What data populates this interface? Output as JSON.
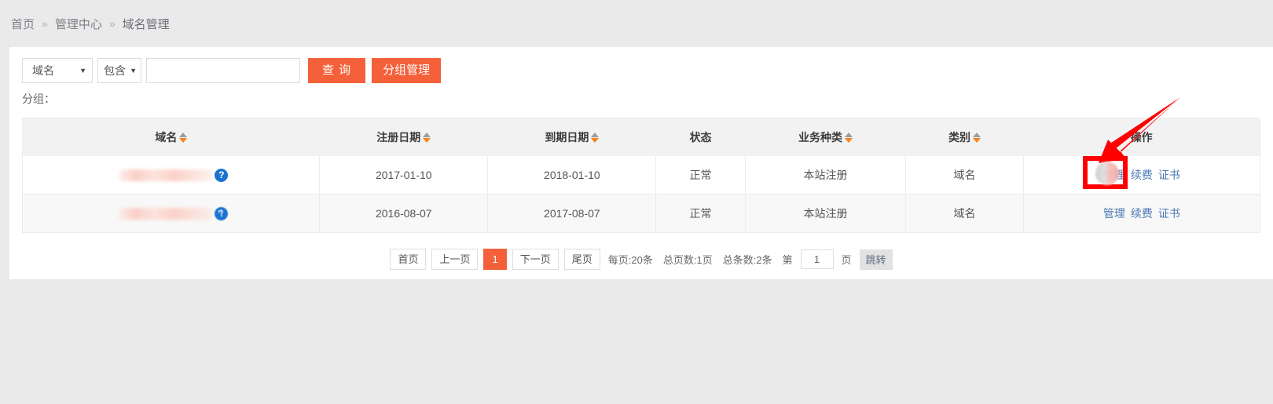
{
  "breadcrumb": {
    "separator": "»",
    "items": [
      {
        "label": "首页"
      },
      {
        "label": "管理中心"
      },
      {
        "label": "域名管理"
      }
    ]
  },
  "filter": {
    "field_select": {
      "value": "域名",
      "caret": "▼"
    },
    "match_select": {
      "value": "包含",
      "caret": "▼"
    },
    "keyword_input": {
      "value": "",
      "placeholder": ""
    },
    "search_button": "查 询",
    "group_manage_button": "分组管理",
    "group_label": "分组："
  },
  "table": {
    "columns": [
      {
        "label": "域名",
        "sortable": true
      },
      {
        "label": "注册日期",
        "sortable": true
      },
      {
        "label": "到期日期",
        "sortable": true
      },
      {
        "label": "状态",
        "sortable": false
      },
      {
        "label": "业务种类",
        "sortable": true
      },
      {
        "label": "类别",
        "sortable": true
      },
      {
        "label": "操作",
        "sortable": false
      }
    ],
    "rows": [
      {
        "domain": "",
        "domain_redacted": true,
        "register_date": "2017-01-10",
        "expire_date": "2018-01-10",
        "status": "正常",
        "business_type": "本站注册",
        "category": "域名",
        "actions": [
          "管理",
          "续费",
          "证书"
        ]
      },
      {
        "domain": "",
        "domain_redacted": true,
        "register_date": "2016-08-07",
        "expire_date": "2017-08-07",
        "status": "正常",
        "business_type": "本站注册",
        "category": "域名",
        "actions": [
          "管理",
          "续费",
          "证书"
        ]
      }
    ]
  },
  "pagination": {
    "first": "首页",
    "prev": "上一页",
    "current_page": "1",
    "next": "下一页",
    "last": "尾页",
    "per_page": "每页:20条",
    "total_pages": "总页数:1页",
    "total_records": "总条数:2条",
    "jump_prefix": "第",
    "jump_value": "1",
    "jump_suffix": "页",
    "jump_button": "跳转"
  },
  "annotations": {
    "highlight_target": "管理",
    "arrow_color": "#fe0000",
    "box_color": "#fe0000"
  },
  "colors": {
    "accent_orange": "#f4603a",
    "sort_active": "#f58220",
    "link_blue": "#4a78b5",
    "page_bg": "#eaeaea",
    "card_bg": "#ffffff",
    "header_bg": "#f2f2f2"
  }
}
